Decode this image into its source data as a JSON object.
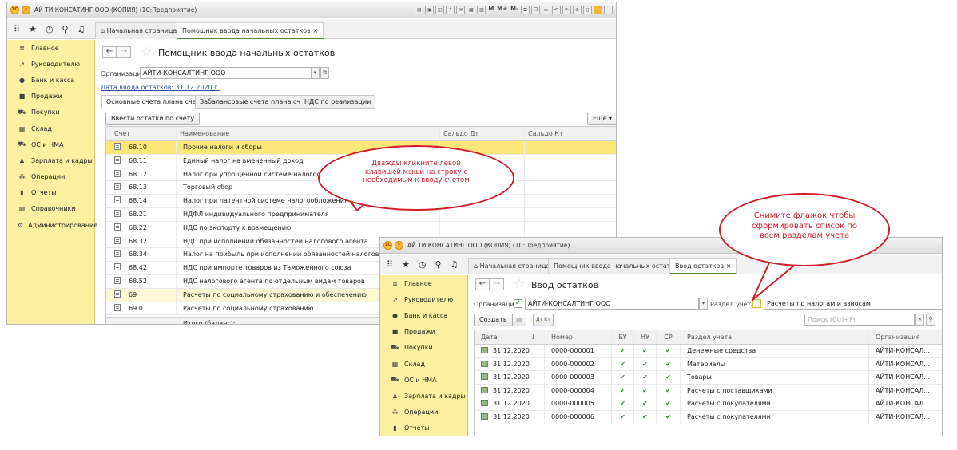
{
  "win1": {
    "title": "АЙ ТИ КОНСАТИНГ ООО (КОПИЯ)  (1С:Предприятие)",
    "titlebar_buttons": [
      "M",
      "M+",
      "M-"
    ],
    "tabs": [
      {
        "label": "Начальная страница",
        "icon": "home-icon"
      },
      {
        "label": "Помощник ввода начальных остатков",
        "close": "×"
      }
    ],
    "sidebar": [
      {
        "label": "Главное",
        "icon": "menu-lines-icon"
      },
      {
        "label": "Руководителю",
        "icon": "chart-trend-icon"
      },
      {
        "label": "Банк и касса",
        "icon": "coins-icon"
      },
      {
        "label": "Продажи",
        "icon": "bag-icon"
      },
      {
        "label": "Покупки",
        "icon": "cart-icon"
      },
      {
        "label": "Склад",
        "icon": "warehouse-icon"
      },
      {
        "label": "ОС и НМА",
        "icon": "truck-icon"
      },
      {
        "label": "Зарплата и кадры",
        "icon": "person-icon"
      },
      {
        "label": "Операции",
        "icon": "operations-icon"
      },
      {
        "label": "Отчеты",
        "icon": "bar-chart-icon"
      },
      {
        "label": "Справочники",
        "icon": "book-icon"
      },
      {
        "label": "Администрирование",
        "icon": "gear-icon"
      }
    ],
    "page_title": "Помощник ввода начальных остатков",
    "org_label": "Организация:",
    "org_value": "АЙТИ-КОНСАЛТИНГ ООО",
    "date_link": "Дата ввода остатков: 31.12.2020 г.",
    "subtabs": [
      "Основные счета плана счетов",
      "Забалансовые счета плана счетов",
      "НДС по реализации"
    ],
    "enter_button": "Ввести остатки по счету",
    "more_button": "Еще",
    "columns": [
      "Счет",
      "Наименование",
      "Сальдо Дт",
      "Сальдо Кт"
    ],
    "rows": [
      {
        "account": "68.10",
        "name": "Прочие налоги и сборы",
        "selected": true
      },
      {
        "account": "68.11",
        "name": "Единый налог на вмененный доход"
      },
      {
        "account": "68.12",
        "name": "Налог при упрощенной системе налогообложения"
      },
      {
        "account": "68.13",
        "name": "Торговый сбор"
      },
      {
        "account": "68.14",
        "name": "Налог при патентной системе налогообложения"
      },
      {
        "account": "68.21",
        "name": "НДФЛ индивидуального предпринимателя"
      },
      {
        "account": "68.22",
        "name": "НДС по экспорту к возмещению"
      },
      {
        "account": "68.32",
        "name": "НДС при исполнении обязанностей налогового агента"
      },
      {
        "account": "68.34",
        "name": "Налог на прибыль при исполнении обязанностей налогового агента"
      },
      {
        "account": "68.42",
        "name": "НДС при импорте товаров из Таможенного союза"
      },
      {
        "account": "68.52",
        "name": "НДС налогового агента по отдельным видам товаров"
      },
      {
        "account": "69",
        "name": "Расчеты по социальному страхованию и обеспечению",
        "group": true
      },
      {
        "account": "69.01",
        "name": "Расчеты по социальному страхованию"
      }
    ],
    "total_label": "Итого (баланс):"
  },
  "callout1": {
    "text": "Дважды кликните левой клавишей мыши на строку с необходимым к вводу счетом"
  },
  "callout2": {
    "text": "Снимите флажок чтобы сформировать список по всем разделам учета"
  },
  "win2": {
    "title": "АЙ ТИ КОНСАТИНГ ООО (КОПИЯ)  (1С:Предприятие)",
    "tabs": [
      {
        "label": "Начальная страница",
        "icon": "home-icon"
      },
      {
        "label": "Помощник ввода начальных остатков",
        "close": "×"
      },
      {
        "label": "Ввод остатков",
        "close": "×"
      }
    ],
    "sidebar": [
      {
        "label": "Главное",
        "icon": "menu-lines-icon"
      },
      {
        "label": "Руководителю",
        "icon": "chart-trend-icon"
      },
      {
        "label": "Банк и касса",
        "icon": "coins-icon"
      },
      {
        "label": "Продажи",
        "icon": "bag-icon"
      },
      {
        "label": "Покупки",
        "icon": "cart-icon"
      },
      {
        "label": "Склад",
        "icon": "warehouse-icon"
      },
      {
        "label": "ОС и НМА",
        "icon": "truck-icon"
      },
      {
        "label": "Зарплата и кадры",
        "icon": "person-icon"
      },
      {
        "label": "Операции",
        "icon": "operations-icon"
      },
      {
        "label": "Отчеты",
        "icon": "bar-chart-icon"
      }
    ],
    "page_title": "Ввод остатков",
    "org_label": "Организация:",
    "org_value": "АЙТИ-КОНСАЛТИНГ ООО",
    "section_label": "Раздел учета:",
    "section_value": "Расчеты по налогам и взносам",
    "create_button": "Создать",
    "search_placeholder": "Поиск (Ctrl+F)",
    "columns": [
      "Дата",
      "Номер",
      "БУ",
      "НУ",
      "СР",
      "Раздел учета",
      "Организация"
    ],
    "sort_arrow": "↓",
    "check_mark": "✔",
    "rows": [
      {
        "date": "31.12.2020",
        "number": "0000-000001",
        "section": "Денежные средства",
        "org": "АЙТИ-КОНСАЛ..."
      },
      {
        "date": "31.12.2020",
        "number": "0000-000002",
        "section": "Материалы",
        "org": "АЙТИ-КОНСАЛ..."
      },
      {
        "date": "31.12.2020",
        "number": "0000-000003",
        "section": "Товары",
        "org": "АЙТИ-КОНСАЛ..."
      },
      {
        "date": "31.12.2020",
        "number": "0000-000004",
        "section": "Расчеты с поставщиками",
        "org": "АЙТИ-КОНСАЛ..."
      },
      {
        "date": "31.12.2020",
        "number": "0000-000005",
        "section": "Расчеты с покупателями",
        "org": "АЙТИ-КОНСАЛ..."
      },
      {
        "date": "31.12.2020",
        "number": "0000-000006",
        "section": "Расчеты с покупателями",
        "org": "АЙТИ-КОНСАЛ..."
      }
    ]
  },
  "colors": {
    "sidebar": "#fdf0a0",
    "selected_row": "#fbe879",
    "callout": "#d21d2a",
    "check": "#2e8b2e"
  }
}
